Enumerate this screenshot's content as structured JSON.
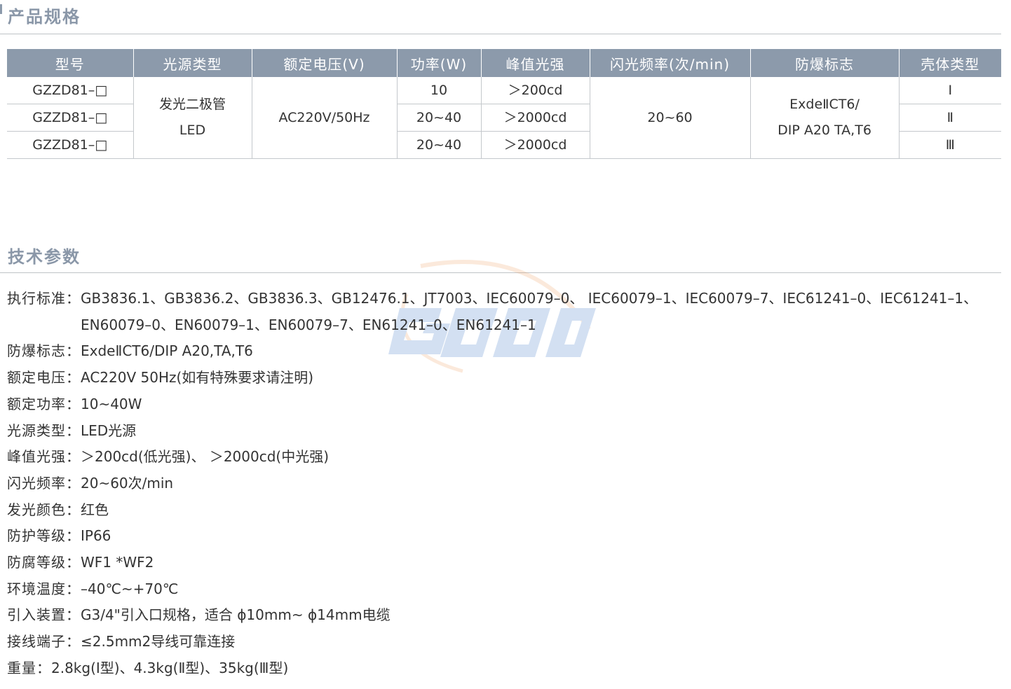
{
  "spec_section": {
    "title": "产品规格"
  },
  "spec_table": {
    "headers": [
      "型号",
      "光源类型",
      "额定电压(V)",
      "功率(W)",
      "峰值光强",
      "闪光频率(次/min)",
      "防爆标志",
      "壳体类型"
    ],
    "models": [
      "GZZD81–□",
      "GZZD81–□",
      "GZZD81–□"
    ],
    "light_source": [
      "发光二极管",
      "LED"
    ],
    "voltage": "AC220V/50Hz",
    "power": [
      "10",
      "20~40",
      "20~40"
    ],
    "peak": [
      "＞200cd",
      "＞2000cd",
      "＞2000cd"
    ],
    "frequency": "20~60",
    "ex_mark": [
      "ExdeⅡCT6/",
      "DIP A20 TA,T6"
    ],
    "housing": [
      "Ⅰ",
      "Ⅱ",
      "Ⅲ"
    ]
  },
  "tech_section": {
    "title": "技术参数"
  },
  "params": [
    {
      "label": "执行标准：",
      "value": "GB3836.1、GB3836.2、GB3836.3、GB12476.1、JT7003、IEC60079–0、 IEC60079–1、IEC60079–7、IEC61241–0、IEC61241–1、EN60079–0、EN60079–1、EN60079–7、EN61241–0、EN61241–1"
    },
    {
      "label": "防爆标志：",
      "value": "ExdeⅡCT6/DIP A20,TA,T6"
    },
    {
      "label": "额定电压：",
      "value": "AC220V  50Hz(如有特殊要求请注明)"
    },
    {
      "label": "额定功率：",
      "value": "10~40W"
    },
    {
      "label": "光源类型：",
      "value": "LED光源"
    },
    {
      "label": "峰值光强：",
      "value": " ＞200cd(低光强)、 ＞2000cd(中光强)"
    },
    {
      "label": "闪光频率：",
      "value": "20~60次/min"
    },
    {
      "label": "发光颜色：",
      "value": " 红色"
    },
    {
      "label": "防护等级：",
      "value": "IP66"
    },
    {
      "label": "防腐等级：",
      "value": "WF1 *WF2"
    },
    {
      "label": "环境温度：",
      "value": "–40℃~+70℃"
    },
    {
      "label": "引入装置：",
      "value": "G3/4\"引入口规格，适合 ϕ10mm~ ϕ14mm电缆"
    },
    {
      "label": "接线端子：",
      "value": " ≤2.5mm2导线可靠连接"
    },
    {
      "label": "重量：",
      "value": "2.8kg(Ⅰ型)、4.3kg(Ⅱ型)、35kg(Ⅲ型)"
    }
  ],
  "colors": {
    "accent": "#8c9aab",
    "text": "#333333",
    "rule": "#c4c8cc"
  }
}
